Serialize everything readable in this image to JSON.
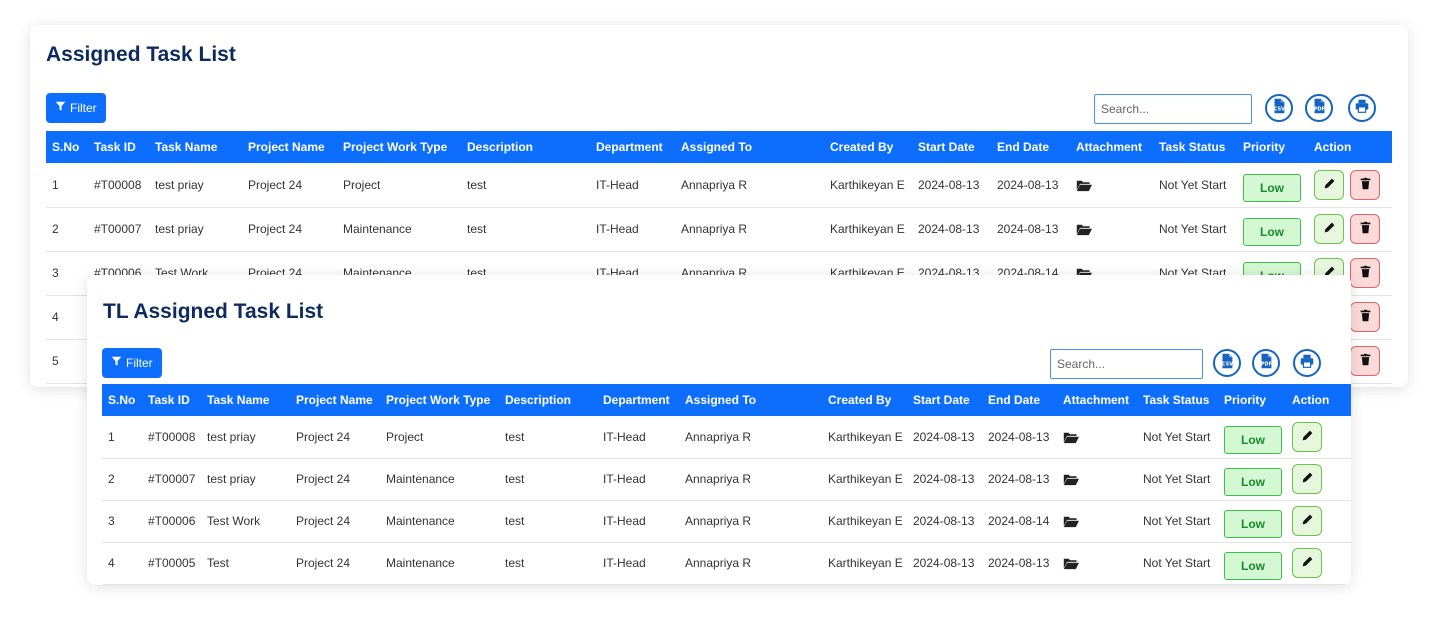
{
  "assigned": {
    "title": "Assigned Task List",
    "filter_label": "Filter",
    "search_placeholder": "Search...",
    "headers": [
      "S.No",
      "Task ID",
      "Task Name",
      "Project Name",
      "Project Work Type",
      "Description",
      "Department",
      "Assigned To",
      "Created By",
      "Start Date",
      "End Date",
      "Attachment",
      "Task Status",
      "Priority",
      "Action"
    ],
    "rows": [
      {
        "sno": "1",
        "task_id": "#T00008",
        "task_name": "test priay",
        "project": "Project 24",
        "work_type": "Project",
        "description": "test",
        "department": "IT-Head",
        "assigned_to": "Annapriya R",
        "created_by": "Karthikeyan E",
        "start": "2024-08-13",
        "end": "2024-08-13",
        "status": "Not Yet Start",
        "priority": "Low"
      },
      {
        "sno": "2",
        "task_id": "#T00007",
        "task_name": "test priay",
        "project": "Project 24",
        "work_type": "Maintenance",
        "description": "test",
        "department": "IT-Head",
        "assigned_to": "Annapriya R",
        "created_by": "Karthikeyan E",
        "start": "2024-08-13",
        "end": "2024-08-13",
        "status": "Not Yet Start",
        "priority": "Low"
      },
      {
        "sno": "3",
        "task_id": "#T00006",
        "task_name": "Test Work",
        "project": "Project 24",
        "work_type": "Maintenance",
        "description": "test",
        "department": "IT-Head",
        "assigned_to": "Annapriya R",
        "created_by": "Karthikeyan E",
        "start": "2024-08-13",
        "end": "2024-08-14",
        "status": "Not Yet Start",
        "priority": "Low"
      },
      {
        "sno": "4"
      },
      {
        "sno": "5"
      }
    ]
  },
  "tl": {
    "title": "TL Assigned Task List",
    "filter_label": "Filter",
    "search_placeholder": "Search...",
    "headers": [
      "S.No",
      "Task ID",
      "Task Name",
      "Project Name",
      "Project Work Type",
      "Description",
      "Department",
      "Assigned To",
      "Created By",
      "Start Date",
      "End Date",
      "Attachment",
      "Task Status",
      "Priority",
      "Action"
    ],
    "rows": [
      {
        "sno": "1",
        "task_id": "#T00008",
        "task_name": "test priay",
        "project": "Project 24",
        "work_type": "Project",
        "description": "test",
        "department": "IT-Head",
        "assigned_to": "Annapriya R",
        "created_by": "Karthikeyan E",
        "start": "2024-08-13",
        "end": "2024-08-13",
        "status": "Not Yet Start",
        "priority": "Low"
      },
      {
        "sno": "2",
        "task_id": "#T00007",
        "task_name": "test priay",
        "project": "Project 24",
        "work_type": "Maintenance",
        "description": "test",
        "department": "IT-Head",
        "assigned_to": "Annapriya R",
        "created_by": "Karthikeyan E",
        "start": "2024-08-13",
        "end": "2024-08-13",
        "status": "Not Yet Start",
        "priority": "Low"
      },
      {
        "sno": "3",
        "task_id": "#T00006",
        "task_name": "Test Work",
        "project": "Project 24",
        "work_type": "Maintenance",
        "description": "test",
        "department": "IT-Head",
        "assigned_to": "Annapriya R",
        "created_by": "Karthikeyan E",
        "start": "2024-08-13",
        "end": "2024-08-14",
        "status": "Not Yet Start",
        "priority": "Low"
      },
      {
        "sno": "4",
        "task_id": "#T00005",
        "task_name": "Test",
        "project": "Project 24",
        "work_type": "Maintenance",
        "description": "test",
        "department": "IT-Head",
        "assigned_to": "Annapriya R",
        "created_by": "Karthikeyan E",
        "start": "2024-08-13",
        "end": "2024-08-13",
        "status": "Not Yet Start",
        "priority": "Low"
      }
    ]
  },
  "icons": {
    "export": [
      "csv-icon",
      "pdf-icon",
      "print-icon"
    ],
    "filter": "filter-icon",
    "attachment": "folder-open-icon",
    "edit": "pencil-icon",
    "delete": "trash-icon"
  },
  "colors": {
    "primary": "#0d6efd",
    "title": "#0d2b5c",
    "priority_low_bg": "#d4f7d4",
    "priority_low_border": "#3cc04a",
    "edit_bg": "#e6f7dd",
    "delete_bg": "#fddada"
  }
}
